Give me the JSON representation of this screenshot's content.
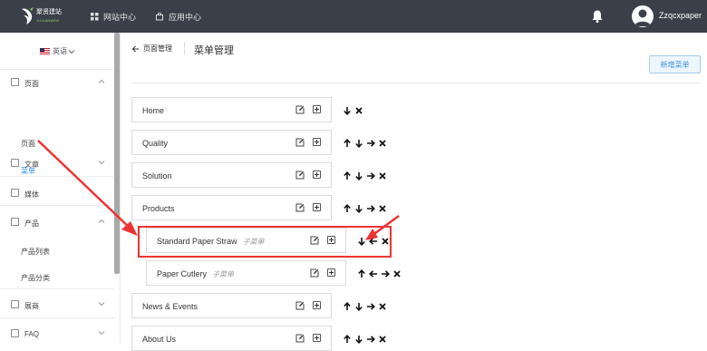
{
  "header": {
    "logo_text": "聚贤建站",
    "logo_subtext": "JUXIANWEB",
    "nav": [
      {
        "label": "网站中心",
        "icon": "grid-icon"
      },
      {
        "label": "应用中心",
        "icon": "bag-icon"
      }
    ],
    "username": "Zzqcxpaper",
    "colors": {
      "bar": "#3b3f4a",
      "accent": "#2d8cf0"
    }
  },
  "sidebar": {
    "language": "英语",
    "groups": [
      {
        "label": "页面",
        "icon": "page-icon",
        "expanded": true
      },
      {
        "label": "文章",
        "icon": "article-icon",
        "expanded": false
      },
      {
        "label": "媒体",
        "icon": "media-icon",
        "expanded": false
      },
      {
        "label": "产品",
        "icon": "product-icon",
        "expanded": true
      },
      {
        "label": "展商",
        "icon": "exhibitor-icon",
        "expanded": false
      },
      {
        "label": "FAQ",
        "icon": "faq-icon",
        "expanded": false
      }
    ],
    "sub_items": [
      {
        "label": "页面",
        "active": false
      },
      {
        "label": "菜单",
        "active": true
      },
      {
        "label": "产品列表",
        "active": false
      },
      {
        "label": "产品分类",
        "active": false
      }
    ]
  },
  "main": {
    "back_label": "页面管理",
    "title": "菜单管理",
    "new_button": "新增菜单",
    "menu_items": [
      {
        "label": "Home",
        "child": false,
        "actions": [
          "down",
          "delete"
        ]
      },
      {
        "label": "Quality",
        "child": false,
        "actions": [
          "up",
          "down",
          "right",
          "delete"
        ]
      },
      {
        "label": "Solution",
        "child": false,
        "actions": [
          "up",
          "down",
          "right",
          "delete"
        ]
      },
      {
        "label": "Products",
        "child": false,
        "actions": [
          "up",
          "down",
          "right",
          "delete"
        ]
      },
      {
        "label": "Standard Paper Straw",
        "child": true,
        "sub_tag": "子菜单",
        "actions": [
          "down",
          "left",
          "delete"
        ]
      },
      {
        "label": "Paper Cutlery",
        "child": true,
        "sub_tag": "子菜单",
        "actions": [
          "up",
          "left",
          "right",
          "delete"
        ]
      },
      {
        "label": "News & Events",
        "child": false,
        "actions": [
          "up",
          "down",
          "right",
          "delete"
        ]
      },
      {
        "label": "About Us",
        "child": false,
        "actions": [
          "up",
          "down",
          "right",
          "delete"
        ]
      }
    ],
    "annotation_color": "#e33333"
  }
}
